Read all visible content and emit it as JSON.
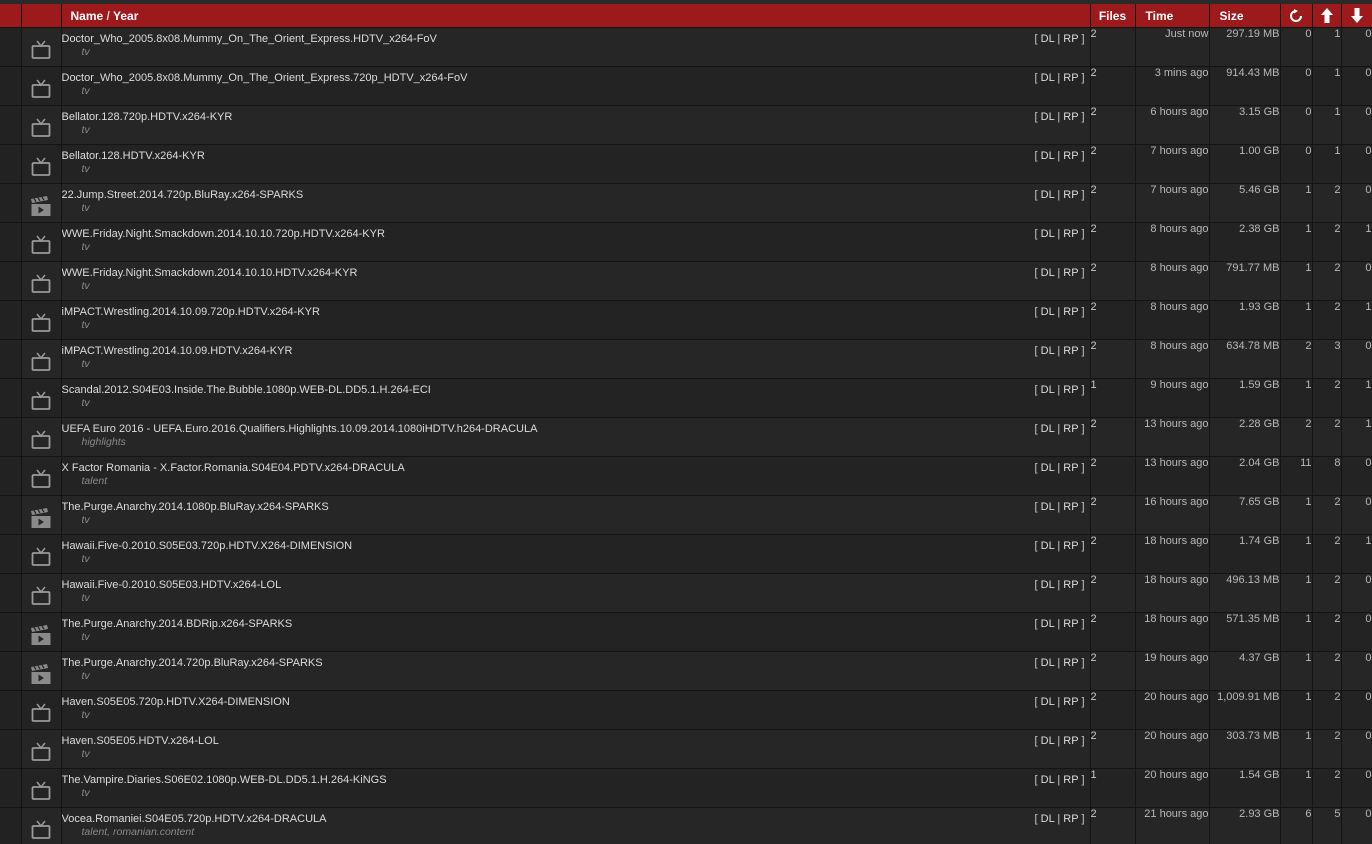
{
  "header": {
    "name_label": "Name",
    "slash": "/",
    "year_label": "Year",
    "files_label": "Files",
    "time_label": "Time",
    "size_label": "Size",
    "refresh_icon": "refresh-icon",
    "up_icon": "arrow-up-icon",
    "down_icon": "arrow-down-icon",
    "accent": "#9c1a1c"
  },
  "links": {
    "open": "[",
    "dl": "DL",
    "sep": "|",
    "rp": "RP",
    "close": "]"
  },
  "rows": [
    {
      "cat": "tv-icon",
      "name": "Doctor_Who_2005.8x08.Mummy_On_The_Orient_Express.HDTV_x264-FoV",
      "sub": "tv",
      "files": "2",
      "time": "Just now",
      "size": "297.19 MB",
      "a": "0",
      "b": "1",
      "c": "0"
    },
    {
      "cat": "tv-icon",
      "name": "Doctor_Who_2005.8x08.Mummy_On_The_Orient_Express.720p_HDTV_x264-FoV",
      "sub": "tv",
      "files": "2",
      "time": "3 mins ago",
      "size": "914.43 MB",
      "a": "0",
      "b": "1",
      "c": "0"
    },
    {
      "cat": "tv-icon",
      "name": "Bellator.128.720p.HDTV.x264-KYR",
      "sub": "tv",
      "files": "2",
      "time": "6 hours ago",
      "size": "3.15 GB",
      "a": "0",
      "b": "1",
      "c": "0"
    },
    {
      "cat": "tv-icon",
      "name": "Bellator.128.HDTV.x264-KYR",
      "sub": "tv",
      "files": "2",
      "time": "7 hours ago",
      "size": "1.00 GB",
      "a": "0",
      "b": "1",
      "c": "0"
    },
    {
      "cat": "movie-icon",
      "name": "22.Jump.Street.2014.720p.BluRay.x264-SPARKS",
      "sub": "tv",
      "files": "2",
      "time": "7 hours ago",
      "size": "5.46 GB",
      "a": "1",
      "b": "2",
      "c": "0"
    },
    {
      "cat": "tv-icon",
      "name": "WWE.Friday.Night.Smackdown.2014.10.10.720p.HDTV.x264-KYR",
      "sub": "tv",
      "files": "2",
      "time": "8 hours ago",
      "size": "2.38 GB",
      "a": "1",
      "b": "2",
      "c": "1"
    },
    {
      "cat": "tv-icon",
      "name": "WWE.Friday.Night.Smackdown.2014.10.10.HDTV.x264-KYR",
      "sub": "tv",
      "files": "2",
      "time": "8 hours ago",
      "size": "791.77 MB",
      "a": "1",
      "b": "2",
      "c": "0"
    },
    {
      "cat": "tv-icon",
      "name": "iMPACT.Wrestling.2014.10.09.720p.HDTV.x264-KYR",
      "sub": "tv",
      "files": "2",
      "time": "8 hours ago",
      "size": "1.93 GB",
      "a": "1",
      "b": "2",
      "c": "1"
    },
    {
      "cat": "tv-icon",
      "name": "iMPACT.Wrestling.2014.10.09.HDTV.x264-KYR",
      "sub": "tv",
      "files": "2",
      "time": "8 hours ago",
      "size": "634.78 MB",
      "a": "2",
      "b": "3",
      "c": "0"
    },
    {
      "cat": "tv-icon",
      "name": "Scandal.2012.S04E03.Inside.The.Bubble.1080p.WEB-DL.DD5.1.H.264-ECI",
      "sub": "tv",
      "files": "1",
      "time": "9 hours ago",
      "size": "1.59 GB",
      "a": "1",
      "b": "2",
      "c": "1"
    },
    {
      "cat": "tv-icon",
      "name": "UEFA Euro 2016 - UEFA.Euro.2016.Qualifiers.Highlights.10.09.2014.1080iHDTV.h264-DRACULA",
      "sub": "highlights",
      "files": "2",
      "time": "13 hours ago",
      "size": "2.28 GB",
      "a": "2",
      "b": "2",
      "c": "1"
    },
    {
      "cat": "tv-icon",
      "name": "X Factor Romania - X.Factor.Romania.S04E04.PDTV.x264-DRACULA",
      "sub": "talent",
      "files": "2",
      "time": "13 hours ago",
      "size": "2.04 GB",
      "a": "11",
      "b": "8",
      "c": "0"
    },
    {
      "cat": "movie-icon",
      "name": "The.Purge.Anarchy.2014.1080p.BluRay.x264-SPARKS",
      "sub": "tv",
      "files": "2",
      "time": "16 hours ago",
      "size": "7.65 GB",
      "a": "1",
      "b": "2",
      "c": "0"
    },
    {
      "cat": "tv-icon",
      "name": "Hawaii.Five-0.2010.S05E03.720p.HDTV.X264-DIMENSION",
      "sub": "tv",
      "files": "2",
      "time": "18 hours ago",
      "size": "1.74 GB",
      "a": "1",
      "b": "2",
      "c": "1"
    },
    {
      "cat": "tv-icon",
      "name": "Hawaii.Five-0.2010.S05E03.HDTV.x264-LOL",
      "sub": "tv",
      "files": "2",
      "time": "18 hours ago",
      "size": "496.13 MB",
      "a": "1",
      "b": "2",
      "c": "0"
    },
    {
      "cat": "movie-icon",
      "name": "The.Purge.Anarchy.2014.BDRip.x264-SPARKS",
      "sub": "tv",
      "files": "2",
      "time": "18 hours ago",
      "size": "571.35 MB",
      "a": "1",
      "b": "2",
      "c": "0"
    },
    {
      "cat": "movie-icon",
      "name": "The.Purge.Anarchy.2014.720p.BluRay.x264-SPARKS",
      "sub": "tv",
      "files": "2",
      "time": "19 hours ago",
      "size": "4.37 GB",
      "a": "1",
      "b": "2",
      "c": "0"
    },
    {
      "cat": "tv-icon",
      "name": "Haven.S05E05.720p.HDTV.X264-DIMENSION",
      "sub": "tv",
      "files": "2",
      "time": "20 hours ago",
      "size": "1,009.91 MB",
      "a": "1",
      "b": "2",
      "c": "0"
    },
    {
      "cat": "tv-icon",
      "name": "Haven.S05E05.HDTV.x264-LOL",
      "sub": "tv",
      "files": "2",
      "time": "20 hours ago",
      "size": "303.73 MB",
      "a": "1",
      "b": "2",
      "c": "0"
    },
    {
      "cat": "tv-icon",
      "name": "The.Vampire.Diaries.S06E02.1080p.WEB-DL.DD5.1.H.264-KiNGS",
      "sub": "tv",
      "files": "1",
      "time": "20 hours ago",
      "size": "1.54 GB",
      "a": "1",
      "b": "2",
      "c": "0"
    },
    {
      "cat": "tv-icon",
      "name": "Vocea.Romaniei.S04E05.720p.HDTV.x264-DRACULA",
      "sub": "talent, romanian.content",
      "files": "2",
      "time": "21 hours ago",
      "size": "2.93 GB",
      "a": "6",
      "b": "5",
      "c": "0"
    }
  ]
}
